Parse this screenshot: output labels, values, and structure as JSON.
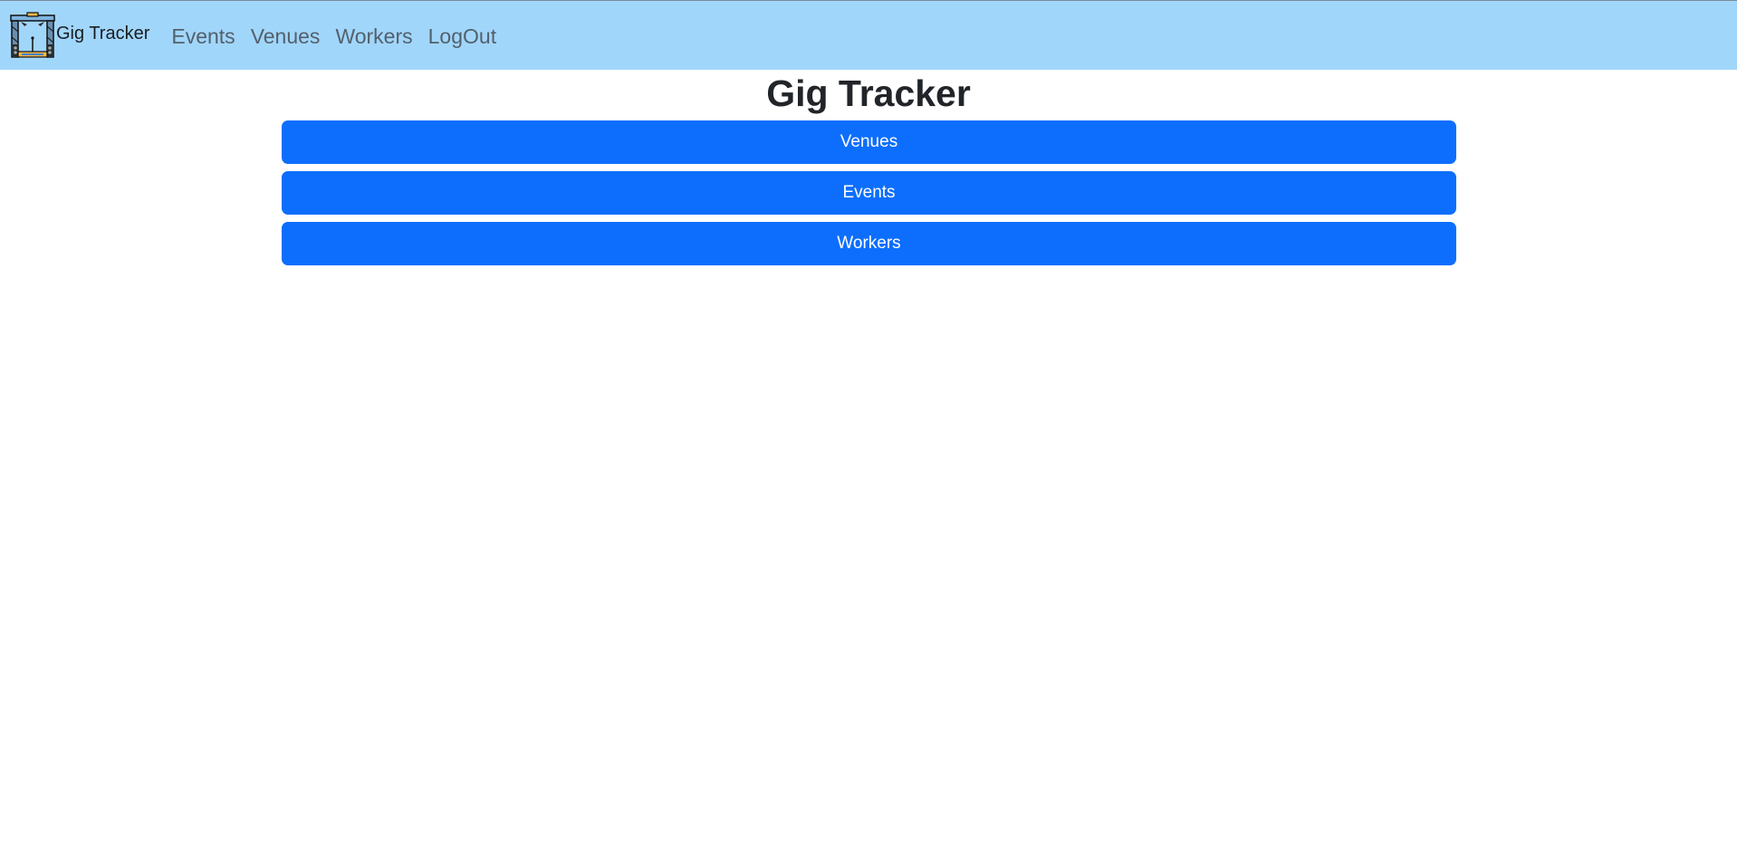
{
  "navbar": {
    "brand_name": "Gig Tracker",
    "logo_icon": "stage-icon",
    "background_color": "#a1d6fb",
    "links": [
      {
        "label": "Events"
      },
      {
        "label": "Venues"
      },
      {
        "label": "Workers"
      },
      {
        "label": "LogOut"
      }
    ]
  },
  "main": {
    "title": "Gig Tracker",
    "button_color": "#0d6efd",
    "buttons": [
      {
        "label": "Venues"
      },
      {
        "label": "Events"
      },
      {
        "label": "Workers"
      }
    ]
  }
}
